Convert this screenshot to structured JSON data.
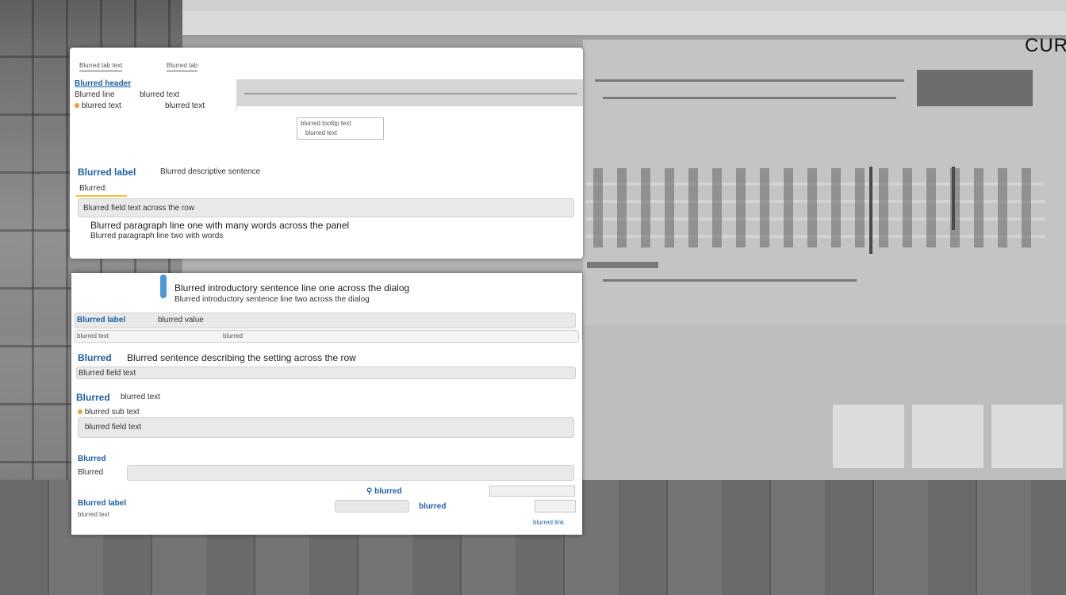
{
  "background": {
    "logo_text": "CURR"
  },
  "dialog1": {
    "tabs": [
      "Blurred tab text",
      "Blurred tab"
    ],
    "header": {
      "title": "Blurred header",
      "line1_left": "Blurred line",
      "line1_right": "blurred text",
      "line2_left": "blurred text",
      "line2_right": "blurred text"
    },
    "tooltip": {
      "line1": "blurred tooltip text",
      "line2": "blurred text"
    },
    "section": {
      "label": "Blurred label",
      "description": "Blurred descriptive sentence",
      "sublabel": "Blurred:"
    },
    "field_text": "Blurred field text across the row",
    "body_line1": "Blurred paragraph line one with many words across the panel",
    "body_line2": "Blurred paragraph line two with words"
  },
  "dialog2": {
    "intro_line1": "Blurred introductory sentence line one across the dialog",
    "intro_line2": "Blurred introductory sentence line two across the dialog",
    "row1": {
      "label": "Blurred label",
      "value": "blurred value",
      "sub_left": "blurred text",
      "sub_right": "blurred"
    },
    "row2": {
      "label": "Blurred",
      "text": "Blurred sentence describing the setting across the row",
      "field": "Blurred field text"
    },
    "row3": {
      "label": "Blurred",
      "text": "blurred text",
      "sub": "blurred sub text",
      "field": "blurred field text"
    },
    "row4": {
      "label": "Blurred",
      "sub": "Blurred"
    },
    "row5": {
      "label": "Blurred label",
      "sub": "blurred text",
      "search_label": "blurred",
      "filter_label": "blurred"
    },
    "footer_link": "blurred link"
  },
  "colors": {
    "accent_blue": "#1d5fa8",
    "highlight_yellow": "#f4c430",
    "dot_orange": "#f0a030"
  }
}
